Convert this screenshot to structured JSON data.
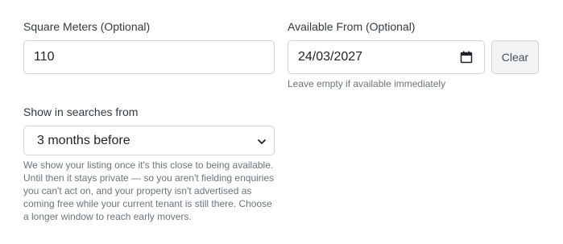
{
  "square_meters": {
    "label": "Square Meters (Optional)",
    "value": "110"
  },
  "available_from": {
    "label": "Available From (Optional)",
    "value": "24/03/2027",
    "clear_label": "Clear",
    "hint": "Leave empty if available immediately"
  },
  "show_in_searches": {
    "label": "Show in searches from",
    "selected": "3 months before",
    "help_lines": [
      "We show your listing once it's this close to being available.",
      "Until then it stays private — so you aren't fielding enquiries",
      "you can't act on, and your property isn't advertised as",
      "coming free while your current tenant is still there. Choose",
      "a longer window to reach early movers."
    ]
  },
  "icons": {
    "calendar": "calendar-icon",
    "dropdown": "chevron-down-icon"
  }
}
